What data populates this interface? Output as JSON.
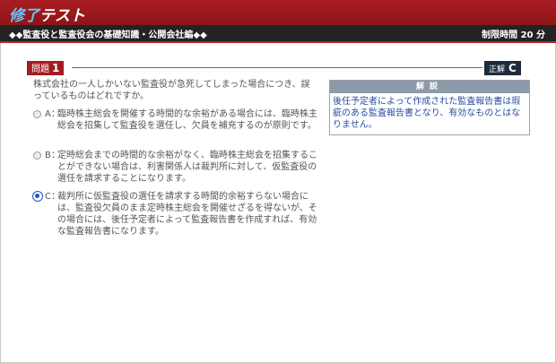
{
  "header": {
    "app_title_part1": "修了",
    "app_title_part2": "テスト",
    "subject": "◆◆監査役と監査役会の基礎知識・公開会社編◆◆",
    "time_limit": "制限時間 20 分"
  },
  "question": {
    "badge_label": "問題",
    "number": "1",
    "text": "株式会社の一人しかいない監査役が急死してしまった場合につき、誤っているものはどれですか。"
  },
  "answer": {
    "badge_label": "正解",
    "value": "C"
  },
  "options": [
    {
      "letter": "A：",
      "text": "臨時株主総会を開催する時間的な余裕がある場合には、臨時株主総会を招集して監査役を選任し、欠員を補充するのが原則です。",
      "selected": false
    },
    {
      "letter": "B：",
      "text": "定時総会までの時間的な余裕がなく、臨時株主総会を招集することができない場合は、利害関係人は裁判所に対して、仮監査役の選任を請求することになります。",
      "selected": false
    },
    {
      "letter": "C：",
      "text": "裁判所に仮監査役の選任を請求する時間的余裕すらない場合には、監査役欠員のまま定時株主総会を開催せざるを得ないが、その場合には、後任予定者によって監査報告書を作成すれば、有効な監査報告書になります。",
      "selected": true
    }
  ],
  "explanation": {
    "heading": "解説",
    "text": "後任予定者によって作成された監査報告書は瑕疵のある監査報告書となり、有効なものとはなりません。"
  },
  "colors": {
    "top_bar": "#a81d22",
    "sub_bar": "#232323",
    "accent_blue": "#2a4da0",
    "explanation_header": "#8d9aa8"
  }
}
